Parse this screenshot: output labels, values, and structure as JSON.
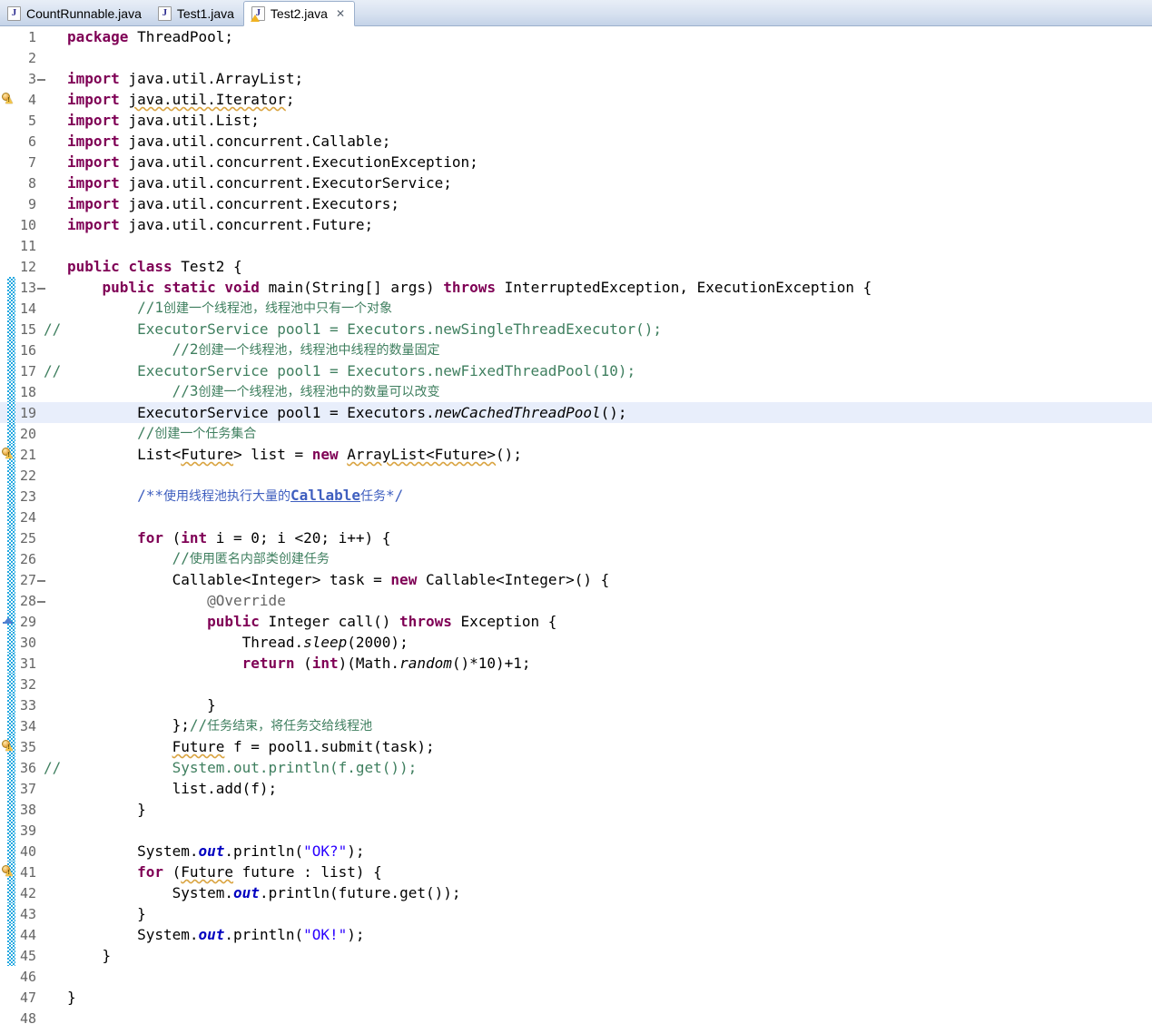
{
  "window": {
    "app": "Eclipse Java Editor"
  },
  "tabs": [
    {
      "label": "CountRunnable.java",
      "icon": "java-file-icon",
      "active": false,
      "closable": false
    },
    {
      "label": "Test1.java",
      "icon": "java-file-icon",
      "active": false,
      "closable": false
    },
    {
      "label": "Test2.java",
      "icon": "java-file-warning-icon",
      "active": true,
      "closable": true,
      "close_glyph": "✕"
    }
  ],
  "editor": {
    "current_line": 19,
    "colors": {
      "keyword": "#7f0055",
      "string": "#2a00ff",
      "comment": "#3f7f5f",
      "javadoc": "#3f5fbf",
      "field": "#0000c0",
      "annotation": "#646464",
      "current_line_bg": "#e8eefb",
      "method_bar": "#23a8e0",
      "warning": "#f2c44a"
    },
    "lines": [
      {
        "n": 1,
        "marker": "",
        "fold": false,
        "commented": false,
        "html": "<span class=\"kw\">package</span> ThreadPool;"
      },
      {
        "n": 2,
        "marker": "",
        "fold": false,
        "commented": false,
        "html": ""
      },
      {
        "n": 3,
        "marker": "",
        "fold": true,
        "commented": false,
        "html": "<span class=\"kw\">import</span> java.util.ArrayList;"
      },
      {
        "n": 4,
        "marker": "warning",
        "fold": false,
        "commented": false,
        "html": "<span class=\"kw\">import</span> <span class=\"warnu\">java.util.Iterator</span>;"
      },
      {
        "n": 5,
        "marker": "",
        "fold": false,
        "commented": false,
        "html": "<span class=\"kw\">import</span> java.util.List;"
      },
      {
        "n": 6,
        "marker": "",
        "fold": false,
        "commented": false,
        "html": "<span class=\"kw\">import</span> java.util.concurrent.Callable;"
      },
      {
        "n": 7,
        "marker": "",
        "fold": false,
        "commented": false,
        "html": "<span class=\"kw\">import</span> java.util.concurrent.ExecutionException;"
      },
      {
        "n": 8,
        "marker": "",
        "fold": false,
        "commented": false,
        "html": "<span class=\"kw\">import</span> java.util.concurrent.ExecutorService;"
      },
      {
        "n": 9,
        "marker": "",
        "fold": false,
        "commented": false,
        "html": "<span class=\"kw\">import</span> java.util.concurrent.Executors;"
      },
      {
        "n": 10,
        "marker": "",
        "fold": false,
        "commented": false,
        "html": "<span class=\"kw\">import</span> java.util.concurrent.Future;"
      },
      {
        "n": 11,
        "marker": "",
        "fold": false,
        "commented": false,
        "html": ""
      },
      {
        "n": 12,
        "marker": "",
        "fold": false,
        "commented": false,
        "html": "<span class=\"kw\">public</span> <span class=\"kw\">class</span> Test2 {"
      },
      {
        "n": 13,
        "marker": "",
        "fold": true,
        "bar": true,
        "commented": false,
        "html": "    <span class=\"kw\">public</span> <span class=\"kw\">static</span> <span class=\"kw\">void</span> main(String[] args) <span class=\"kw\">throws</span> InterruptedException, ExecutionException {"
      },
      {
        "n": 14,
        "marker": "",
        "fold": false,
        "bar": true,
        "commented": false,
        "html": "        <span class=\"cmt\">//1</span><span class=\"cmt cn\">创建一个线程池，线程池中只有一个对象</span>"
      },
      {
        "n": 15,
        "marker": "",
        "fold": false,
        "bar": true,
        "commented": true,
        "html": "        <span class=\"cmt\">ExecutorService pool1 = Executors.newSingleThreadExecutor();</span>"
      },
      {
        "n": 16,
        "marker": "",
        "fold": false,
        "bar": true,
        "commented": false,
        "html": "            <span class=\"cmt\">//2</span><span class=\"cmt cn\">创建一个线程池，线程池中线程的数量固定</span>"
      },
      {
        "n": 17,
        "marker": "",
        "fold": false,
        "bar": true,
        "commented": true,
        "html": "        <span class=\"cmt\">ExecutorService pool1 = Executors.newFixedThreadPool(10);</span>"
      },
      {
        "n": 18,
        "marker": "",
        "fold": false,
        "bar": true,
        "commented": false,
        "html": "            <span class=\"cmt\">//3</span><span class=\"cmt cn\">创建一个线程池，线程池中的数量可以改变</span>"
      },
      {
        "n": 19,
        "marker": "",
        "fold": false,
        "bar": true,
        "commented": false,
        "current": true,
        "html": "        ExecutorService pool1 = Executors.<span class=\"stat\">newCachedThreadPool</span>();"
      },
      {
        "n": 20,
        "marker": "",
        "fold": false,
        "bar": true,
        "commented": false,
        "html": "        <span class=\"cmt\">//</span><span class=\"cmt cn\">创建一个任务集合</span>"
      },
      {
        "n": 21,
        "marker": "warning",
        "fold": false,
        "bar": true,
        "commented": false,
        "html": "        List&lt;<span class=\"warnu\">Future</span>&gt; list = <span class=\"kw\">new</span> <span class=\"warnu\">ArrayList&lt;Future&gt;</span>();"
      },
      {
        "n": 22,
        "marker": "",
        "fold": false,
        "bar": true,
        "commented": false,
        "html": ""
      },
      {
        "n": 23,
        "marker": "",
        "fold": false,
        "bar": true,
        "commented": false,
        "html": "        <span class=\"jdoc\">/**</span><span class=\"jdoc cn\">使用线程池执行大量的</span><span class=\"jdoc-link\">Callable</span><span class=\"jdoc cn\">任务</span><span class=\"jdoc\">*/</span>"
      },
      {
        "n": 24,
        "marker": "",
        "fold": false,
        "bar": true,
        "commented": false,
        "html": ""
      },
      {
        "n": 25,
        "marker": "",
        "fold": false,
        "bar": true,
        "commented": false,
        "html": "        <span class=\"kw\">for</span> (<span class=\"kw\">int</span> i = 0; i &lt;20; i++) {"
      },
      {
        "n": 26,
        "marker": "",
        "fold": false,
        "bar": true,
        "commented": false,
        "html": "            <span class=\"cmt\">//</span><span class=\"cmt cn\">使用匿名内部类创建任务</span>"
      },
      {
        "n": 27,
        "marker": "",
        "fold": true,
        "bar": true,
        "commented": false,
        "html": "            Callable&lt;Integer&gt; task = <span class=\"kw\">new</span> Callable&lt;Integer&gt;() {"
      },
      {
        "n": 28,
        "marker": "",
        "fold": true,
        "bar": true,
        "commented": false,
        "html": "                <span class=\"ann-t\">@Override</span>"
      },
      {
        "n": 29,
        "marker": "override",
        "fold": false,
        "bar": true,
        "commented": false,
        "html": "                <span class=\"kw\">public</span> Integer call() <span class=\"kw\">throws</span> Exception {"
      },
      {
        "n": 30,
        "marker": "",
        "fold": false,
        "bar": true,
        "commented": false,
        "html": "                    Thread.<span class=\"stat\">sleep</span>(2000);"
      },
      {
        "n": 31,
        "marker": "",
        "fold": false,
        "bar": true,
        "commented": false,
        "html": "                    <span class=\"kw\">return</span> (<span class=\"kw\">int</span>)(Math.<span class=\"stat\">random</span>()*10)+1;"
      },
      {
        "n": 32,
        "marker": "",
        "fold": false,
        "bar": true,
        "commented": false,
        "html": ""
      },
      {
        "n": 33,
        "marker": "",
        "fold": false,
        "bar": true,
        "commented": false,
        "html": "                }"
      },
      {
        "n": 34,
        "marker": "",
        "fold": false,
        "bar": true,
        "commented": false,
        "html": "            };<span class=\"cmt\">//</span><span class=\"cmt cn\">任务结束，将任务交给线程池</span>"
      },
      {
        "n": 35,
        "marker": "warning",
        "fold": false,
        "bar": true,
        "commented": false,
        "html": "            <span class=\"warnu\">Future</span> f = pool1.submit(task);"
      },
      {
        "n": 36,
        "marker": "",
        "fold": false,
        "bar": true,
        "commented": true,
        "html": "            <span class=\"cmt\">System.out.println(f.get());</span>"
      },
      {
        "n": 37,
        "marker": "",
        "fold": false,
        "bar": true,
        "commented": false,
        "html": "            list.add(f);"
      },
      {
        "n": 38,
        "marker": "",
        "fold": false,
        "bar": true,
        "commented": false,
        "html": "        }"
      },
      {
        "n": 39,
        "marker": "",
        "fold": false,
        "bar": true,
        "commented": false,
        "html": ""
      },
      {
        "n": 40,
        "marker": "",
        "fold": false,
        "bar": true,
        "commented": false,
        "html": "        System.<span class=\"fld\">out</span>.println(<span class=\"str\">\"OK?\"</span>);"
      },
      {
        "n": 41,
        "marker": "warning",
        "fold": false,
        "bar": true,
        "commented": false,
        "html": "        <span class=\"kw\">for</span> (<span class=\"warnu\">Future</span> future : list) {"
      },
      {
        "n": 42,
        "marker": "",
        "fold": false,
        "bar": true,
        "commented": false,
        "html": "            System.<span class=\"fld\">out</span>.println(future.get());"
      },
      {
        "n": 43,
        "marker": "",
        "fold": false,
        "bar": true,
        "commented": false,
        "html": "        }"
      },
      {
        "n": 44,
        "marker": "",
        "fold": false,
        "bar": true,
        "commented": false,
        "html": "        System.<span class=\"fld\">out</span>.println(<span class=\"str\">\"OK!\"</span>);"
      },
      {
        "n": 45,
        "marker": "",
        "fold": false,
        "bar": true,
        "commented": false,
        "html": "    }"
      },
      {
        "n": 46,
        "marker": "",
        "fold": false,
        "commented": false,
        "html": ""
      },
      {
        "n": 47,
        "marker": "",
        "fold": false,
        "commented": false,
        "html": "}"
      },
      {
        "n": 48,
        "marker": "",
        "fold": false,
        "commented": false,
        "html": ""
      }
    ],
    "comment_gutter_token": "//"
  }
}
